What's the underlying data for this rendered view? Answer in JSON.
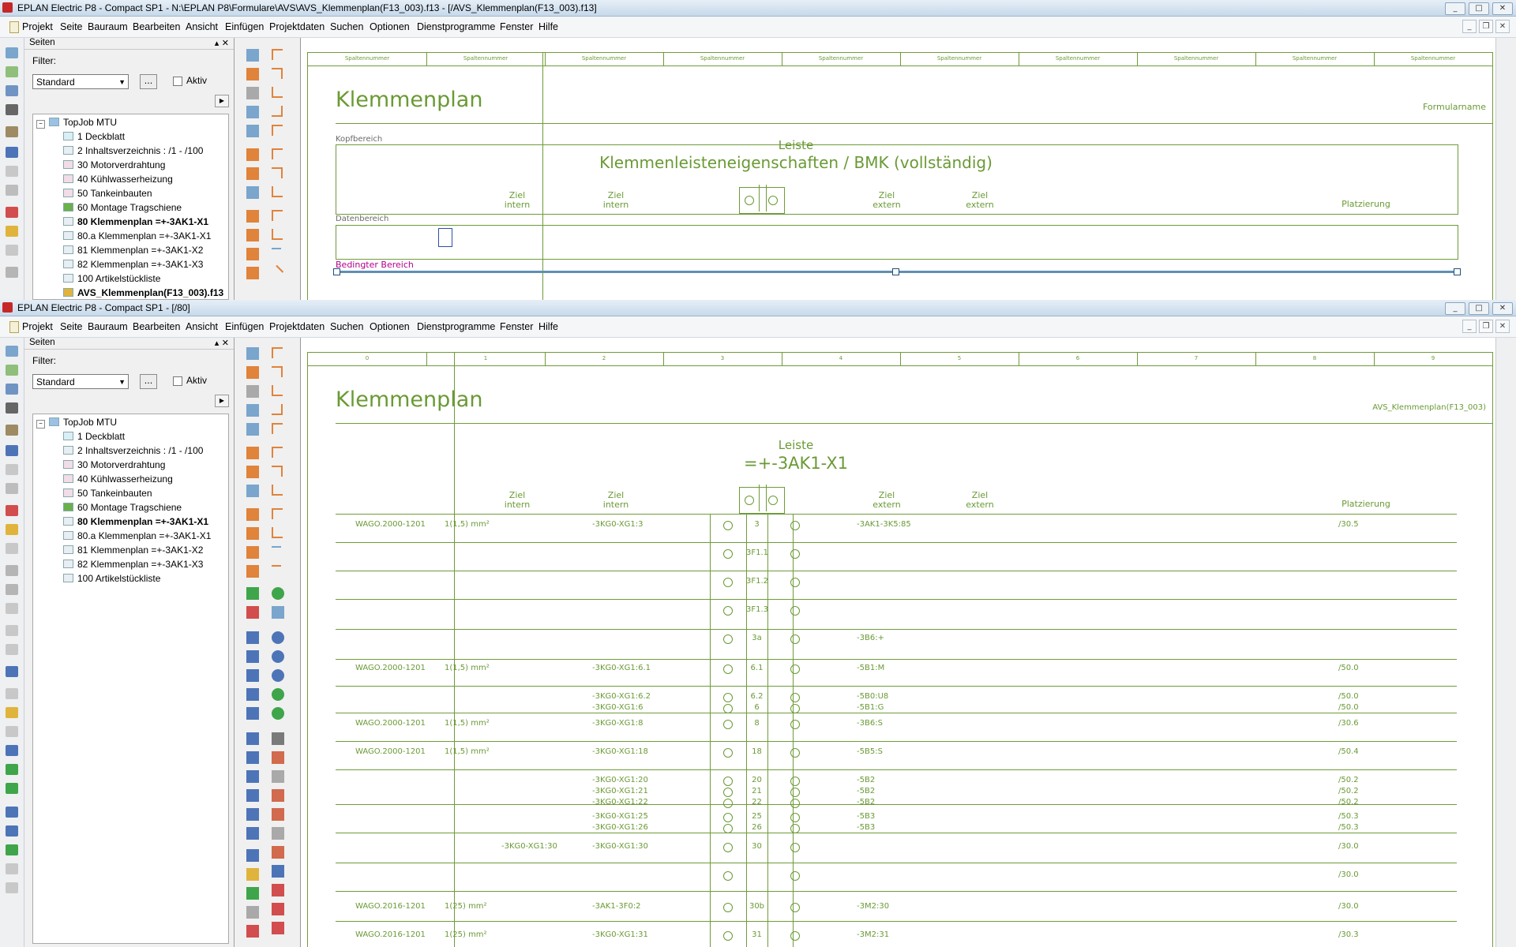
{
  "window1": {
    "title": "EPLAN Electric P8 - Compact SP1 - N:\\EPLAN P8\\Formulare\\AVS\\AVS_Klemmenplan(F13_003).f13 - [/AVS_Klemmenplan(F13_003).f13]",
    "canvas": {
      "column_header_text": "Spaltennummer",
      "title": "Klemmenplan",
      "form_name": "Formularname",
      "kopf_label": "Kopfbereich",
      "leiste_label": "Leiste",
      "leiste_props": "Klemmenleisteneigenschaften / BMK (vollständig)",
      "ziel": "Ziel",
      "intern": "intern",
      "extern": "extern",
      "platzierung": "Platzierung",
      "daten_label": "Datenbereich",
      "bedingt_label": "Bedingter Bereich"
    },
    "tree_extra": "AVS_Klemmenplan(F13_003).f13"
  },
  "window2": {
    "title": "EPLAN Electric P8 - Compact SP1 - [/80]",
    "canvas": {
      "columns": [
        "0",
        "1",
        "2",
        "3",
        "4",
        "5",
        "6",
        "7",
        "8",
        "9"
      ],
      "title": "Klemmenplan",
      "form_name": "AVS_Klemmenplan(F13_003)",
      "leiste_label": "Leiste",
      "leiste_name": "=+-3AK1-X1",
      "ziel": "Ziel",
      "intern": "intern",
      "extern": "extern",
      "platzierung": "Platzierung",
      "rows": [
        {
          "typ": "WAGO.2000-1201",
          "qs": "1(1,5) mm²",
          "zi1": "",
          "zi2": "-3KG0-XG1:3",
          "kl": "3",
          "ze": "-3AK1-3K5:85",
          "pl": "/30.5"
        },
        {
          "typ": "",
          "qs": "",
          "zi1": "",
          "zi2": "",
          "kl": "3F1.1",
          "ze": "",
          "pl": ""
        },
        {
          "typ": "",
          "qs": "",
          "zi1": "",
          "zi2": "",
          "kl": "3F1.2",
          "ze": "",
          "pl": ""
        },
        {
          "typ": "",
          "qs": "",
          "zi1": "",
          "zi2": "",
          "kl": "3F1.3",
          "ze": "",
          "pl": ""
        },
        {
          "typ": "",
          "qs": "",
          "zi1": "",
          "zi2": "",
          "kl": "3a",
          "ze": "-3B6:+",
          "pl": ""
        },
        {
          "typ": "WAGO.2000-1201",
          "qs": "1(1,5) mm²",
          "zi1": "",
          "zi2": "-3KG0-XG1:6.1",
          "kl": "6.1",
          "ze": "-5B1:M",
          "pl": "/50.0"
        },
        {
          "typ": "",
          "qs": "",
          "zi1": "",
          "zi2": "-3KG0-XG1:6.2",
          "kl": "6.2",
          "ze": "-5B0:U8",
          "pl": "/50.0"
        },
        {
          "typ": "",
          "qs": "",
          "zi1": "",
          "zi2": "-3KG0-XG1:6",
          "kl": "6",
          "ze": "-5B1:G",
          "pl": "/50.0"
        },
        {
          "typ": "WAGO.2000-1201",
          "qs": "1(1,5) mm²",
          "zi1": "",
          "zi2": "-3KG0-XG1:8",
          "kl": "8",
          "ze": "-3B6:S",
          "pl": "/30.6"
        },
        {
          "typ": "WAGO.2000-1201",
          "qs": "1(1,5) mm²",
          "zi1": "",
          "zi2": "-3KG0-XG1:18",
          "kl": "18",
          "ze": "-5B5:S",
          "pl": "/50.4"
        },
        {
          "typ": "",
          "qs": "",
          "zi1": "",
          "zi2": "-3KG0-XG1:20",
          "kl": "20",
          "ze": "-5B2",
          "pl": "/50.2"
        },
        {
          "typ": "",
          "qs": "",
          "zi1": "",
          "zi2": "-3KG0-XG1:21",
          "kl": "21",
          "ze": "-5B2",
          "pl": "/50.2"
        },
        {
          "typ": "",
          "qs": "",
          "zi1": "",
          "zi2": "-3KG0-XG1:22",
          "kl": "22",
          "ze": "-5B2",
          "pl": "/50.2"
        },
        {
          "typ": "",
          "qs": "",
          "zi1": "",
          "zi2": "-3KG0-XG1:25",
          "kl": "25",
          "ze": "-5B3",
          "pl": "/50.3"
        },
        {
          "typ": "",
          "qs": "",
          "zi1": "",
          "zi2": "-3KG0-XG1:26",
          "kl": "26",
          "ze": "-5B3",
          "pl": "/50.3"
        },
        {
          "typ": "",
          "qs": "",
          "zi1": "-3KG0-XG1:30",
          "zi2": "-3KG0-XG1:30",
          "kl": "30",
          "ze": "",
          "pl": "/30.0"
        },
        {
          "typ": "",
          "qs": "",
          "zi1": "",
          "zi2": "",
          "kl": "",
          "ze": "",
          "pl": "/30.0"
        },
        {
          "typ": "WAGO.2016-1201",
          "qs": "1(25) mm²",
          "zi1": "",
          "zi2": "-3AK1-3F0:2",
          "kl": "30b",
          "ze": "-3M2:30",
          "pl": "/30.0"
        },
        {
          "typ": "WAGO.2016-1201",
          "qs": "1(25) mm²",
          "zi1": "",
          "zi2": "-3KG0-XG1:31",
          "kl": "31",
          "ze": "-3M2:31",
          "pl": "/30.3"
        }
      ]
    }
  },
  "menu": [
    "Projekt",
    "Seite",
    "Bauraum",
    "Bearbeiten",
    "Ansicht",
    "Einfügen",
    "Projektdaten",
    "Suchen",
    "Optionen",
    "Dienstprogramme",
    "Fenster",
    "Hilfe"
  ],
  "panel": {
    "title": "Seiten",
    "filter_label": "Filter:",
    "filter_value": "Standard",
    "dots": "...",
    "aktiv": "Aktiv"
  },
  "tree": [
    {
      "label": "TopJob MTU",
      "bold": false,
      "level": 0
    },
    {
      "label": "1 Deckblatt",
      "bold": false,
      "level": 1
    },
    {
      "label": "2 Inhaltsverzeichnis : /1 - /100",
      "bold": false,
      "level": 1
    },
    {
      "label": "30 Motorverdrahtung",
      "bold": false,
      "level": 1
    },
    {
      "label": "40 Kühlwasserheizung",
      "bold": false,
      "level": 1
    },
    {
      "label": "50 Tankeinbauten",
      "bold": false,
      "level": 1
    },
    {
      "label": "60 Montage Tragschiene",
      "bold": false,
      "level": 1
    },
    {
      "label": "80 Klemmenplan =+-3AK1-X1",
      "bold": true,
      "level": 1
    },
    {
      "label": "80.a Klemmenplan =+-3AK1-X1",
      "bold": false,
      "level": 1
    },
    {
      "label": "81 Klemmenplan =+-3AK1-X2",
      "bold": false,
      "level": 1
    },
    {
      "label": "82 Klemmenplan =+-3AK1-X3",
      "bold": false,
      "level": 1
    },
    {
      "label": "100 Artikelstückliste",
      "bold": false,
      "level": 1
    }
  ],
  "colors": {
    "drawing": "#6a9a35",
    "conditional": "#b0008c",
    "bar": "#5f8fb4"
  }
}
